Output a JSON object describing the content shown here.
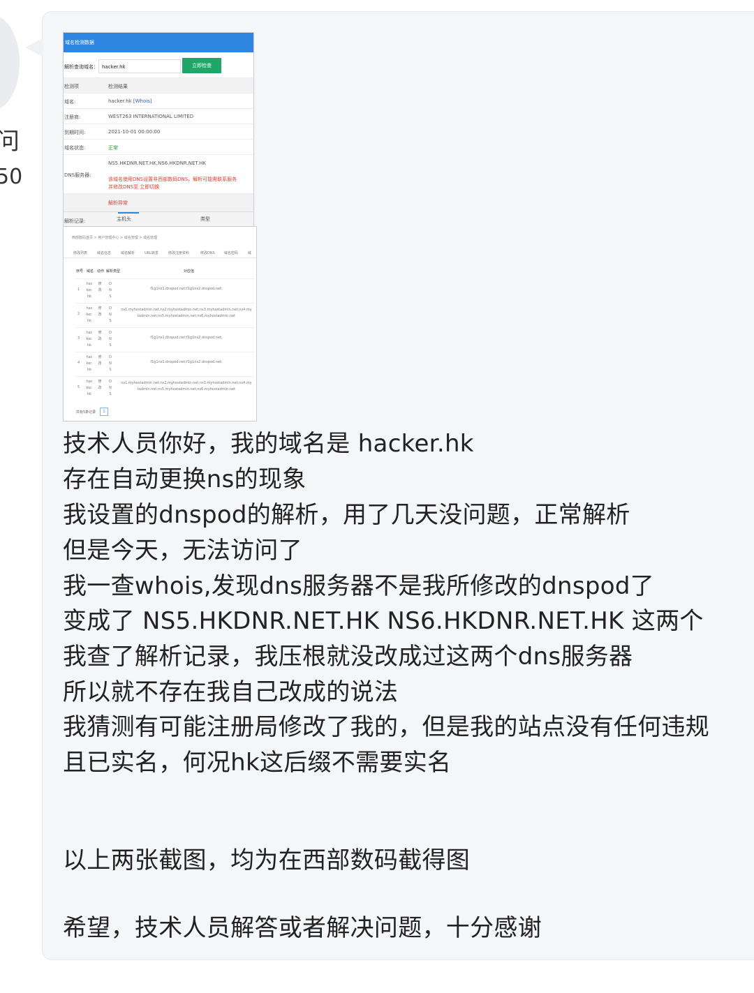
{
  "sidebar": {
    "char": "问",
    "number": "50"
  },
  "screenshot1": {
    "header": "域名检测数据",
    "search_label": "解析查询域名：",
    "search_value": "hacker.hk",
    "search_button": "立即检查",
    "rows": [
      {
        "key": "检测项",
        "value": "检测结果"
      },
      {
        "key": "域名:",
        "value": "hacker.hk",
        "link": "[Whois]"
      },
      {
        "key": "注册商:",
        "value": "WEST263 INTERNATIONAL LIMITED"
      },
      {
        "key": "到期时间:",
        "value": "2021-10-01 00:00:00"
      },
      {
        "key": "域名状态:",
        "value": "正常"
      },
      {
        "key": "DNS服务器:",
        "value": "NS5.HKDNR.NET.HK,NS6.HKDNR.NET.HK",
        "warn1": "该域名使用DNS设置非西部数码DNS，解析可能需联系服务",
        "warn2": "并修改DNS至 立即切换"
      },
      {
        "key": "",
        "value": "解析异常"
      },
      {
        "key": "解析记录:",
        "value": "主机头",
        "extra": "类型"
      }
    ]
  },
  "screenshot2": {
    "breadcrumb": "西部数码首页  >  用户管理中心  >  域名管理  >  域名管理",
    "tabs": [
      "修改列表",
      "域名信息",
      "域名解析",
      "URL转发",
      "修改注册资料",
      "修改DNS",
      "域名密码",
      "域"
    ],
    "headers": [
      "序号",
      "域名",
      "动作",
      "解析类型",
      "对应值"
    ],
    "rows": [
      {
        "no": "1",
        "domain": "hac ker. hk",
        "action": "修改",
        "type": "D N S",
        "value1": "f1g1ns1.dnspod.net;f1g1ns2.dnspod.net;",
        "value2": ""
      },
      {
        "no": "2",
        "domain": "hac ker. hk",
        "action": "修改",
        "type": "D N S",
        "value1": "ns1.myhostadmin.net;ns2.myhostadmin.net;ns3.myhostadmin.net;ns4.my",
        "value2": "tadmin.net;ns5.myhostadmin.net;ns6.myhostadmin.net"
      },
      {
        "no": "3",
        "domain": "hac ker. hk",
        "action": "修改",
        "type": "D N S",
        "value1": "f1g1ns1.dnspod.net;f1g1ns2.dnspod.net;",
        "value2": ""
      },
      {
        "no": "4",
        "domain": "hac ker. hk",
        "action": "修改",
        "type": "D N S",
        "value1": "f1g1ns1.dnspod.net;f1g1ns2.dnspod.net;",
        "value2": ""
      },
      {
        "no": "5",
        "domain": "hac ker. hk",
        "action": "修改",
        "type": "D N S",
        "value1": "ns1.myhostadmin.net;ns2.myhostadmin.net;ns3.myhostadmin.net;ns4.my",
        "value2": "tadmin.net;ns5.myhostadmin.net;ns6.myhostadmin.net"
      }
    ],
    "footer": "共有5条记录",
    "page": "1"
  },
  "message": {
    "lines": [
      "技术人员你好，我的域名是 hacker.hk",
      "存在自动更换ns的现象",
      "我设置的dnspod的解析，用了几天没问题，正常解析",
      "但是今天，无法访问了",
      "我一查whois,发现dns服务器不是我所修改的dnspod了",
      "变成了 NS5.HKDNR.NET.HK   NS6.HKDNR.NET.HK 这两个",
      "我查了解析记录，我压根就没改成过这两个dns服务器",
      "所以就不存在我自己改成的说法",
      "我猜测有可能注册局修改了我的，但是我的站点没有任何违规",
      "且已实名，何况hk这后缀不需要实名"
    ],
    "line_screens": "以上两张截图，均为在西部数码截得图",
    "line_hope": "希望，技术人员解答或者解决问题，十分感谢"
  }
}
